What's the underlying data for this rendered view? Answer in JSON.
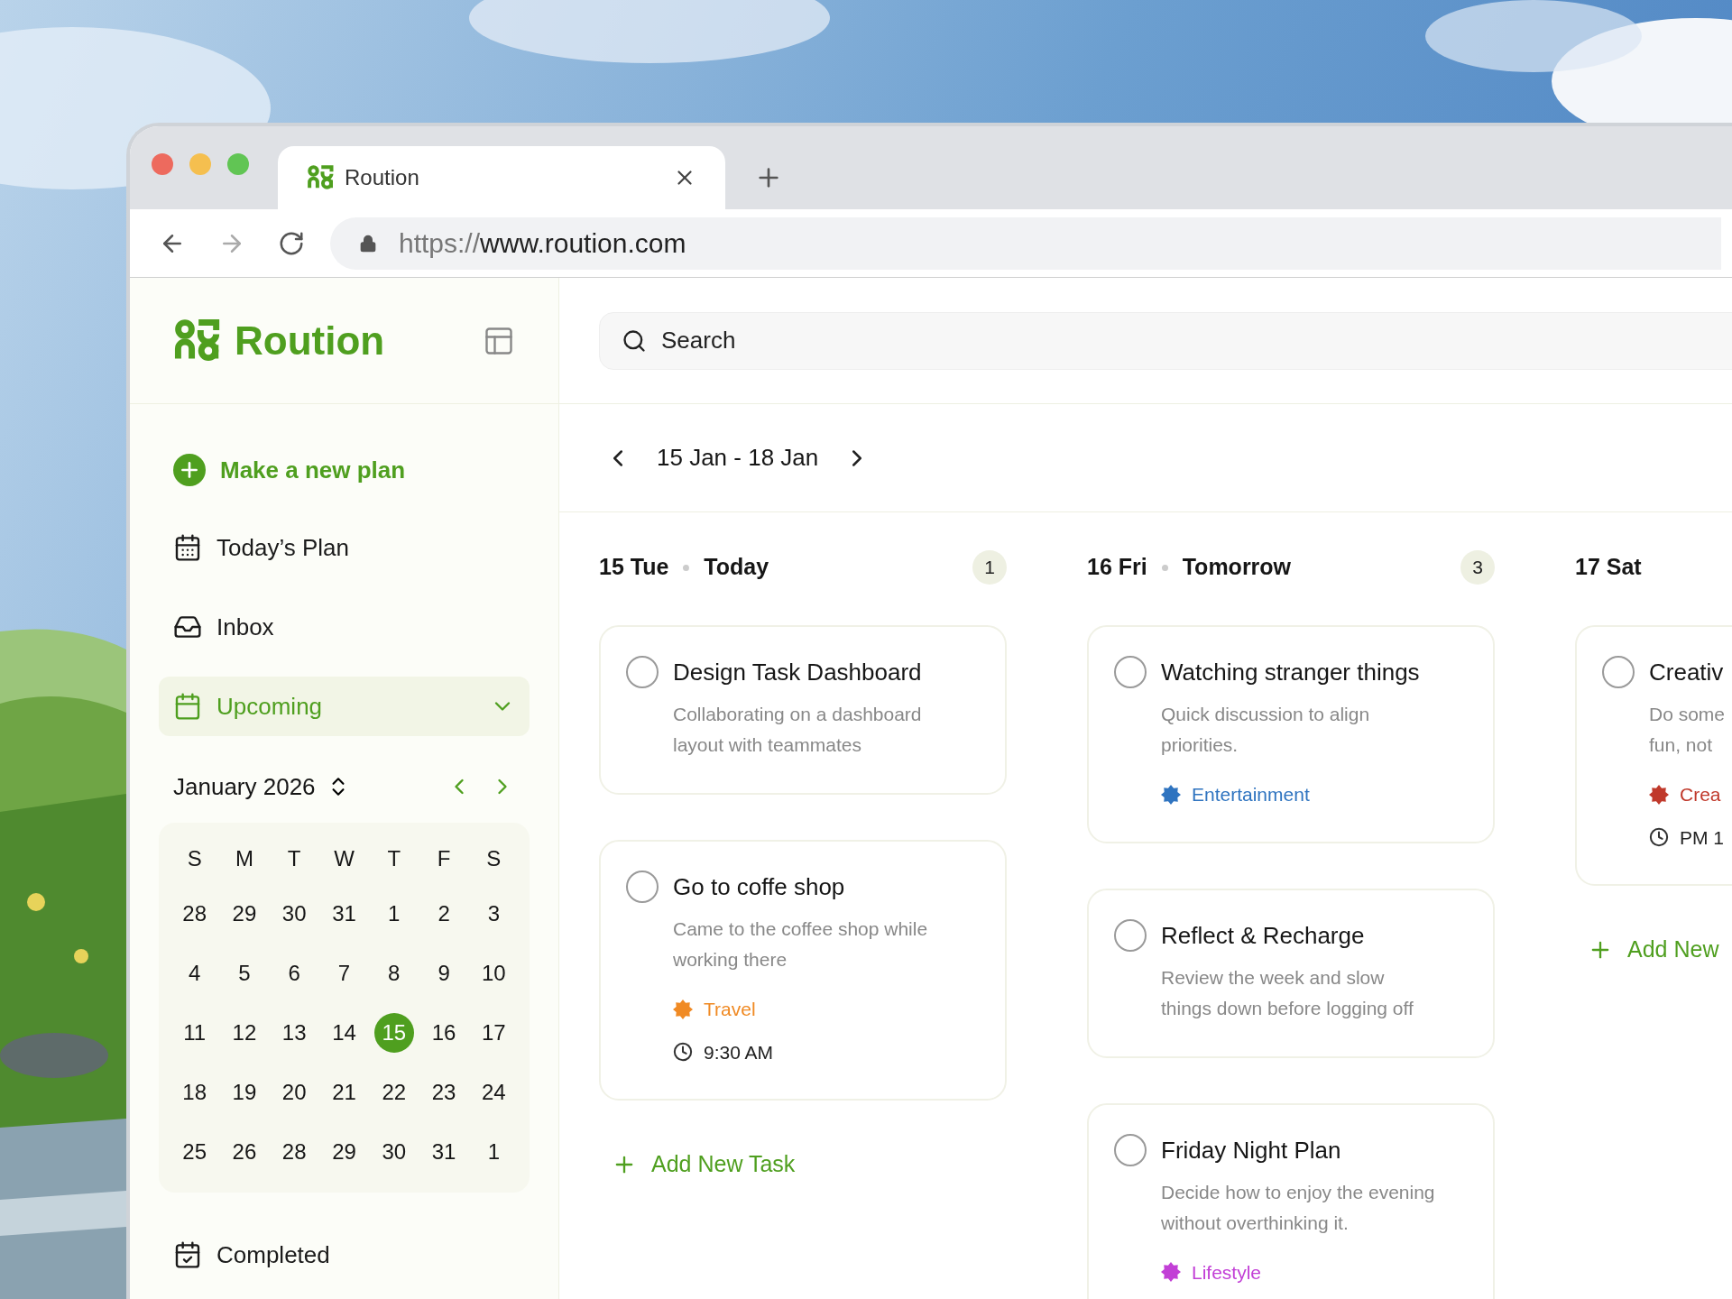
{
  "browser": {
    "tab_title": "Roution",
    "url_scheme": "https://",
    "url_host": "www.roution.com"
  },
  "sidebar": {
    "brand": "Roution",
    "new_plan": "Make a new plan",
    "items": [
      {
        "kind": "today",
        "label": "Today’s Plan",
        "selected": false
      },
      {
        "kind": "inbox",
        "label": "Inbox",
        "selected": false
      },
      {
        "kind": "upcoming",
        "label": "Upcoming",
        "selected": true,
        "expanded": true
      }
    ],
    "calendar": {
      "month": "January 2026",
      "weekdays": [
        "S",
        "M",
        "T",
        "W",
        "T",
        "F",
        "S"
      ],
      "weeks": [
        [
          {
            "day": "28",
            "selected": false
          },
          {
            "day": "29",
            "selected": false
          },
          {
            "day": "30",
            "selected": false
          },
          {
            "day": "31",
            "selected": false
          },
          {
            "day": "1",
            "selected": false
          },
          {
            "day": "2",
            "selected": false
          },
          {
            "day": "3",
            "selected": false
          }
        ],
        [
          {
            "day": "4",
            "selected": false
          },
          {
            "day": "5",
            "selected": false
          },
          {
            "day": "6",
            "selected": false
          },
          {
            "day": "7",
            "selected": false
          },
          {
            "day": "8",
            "selected": false
          },
          {
            "day": "9",
            "selected": false
          },
          {
            "day": "10",
            "selected": false
          }
        ],
        [
          {
            "day": "11",
            "selected": false
          },
          {
            "day": "12",
            "selected": false
          },
          {
            "day": "13",
            "selected": false
          },
          {
            "day": "14",
            "selected": false
          },
          {
            "day": "15",
            "selected": true
          },
          {
            "day": "16",
            "selected": false
          },
          {
            "day": "17",
            "selected": false
          }
        ],
        [
          {
            "day": "18",
            "selected": false
          },
          {
            "day": "19",
            "selected": false
          },
          {
            "day": "20",
            "selected": false
          },
          {
            "day": "21",
            "selected": false
          },
          {
            "day": "22",
            "selected": false
          },
          {
            "day": "23",
            "selected": false
          },
          {
            "day": "24",
            "selected": false
          }
        ],
        [
          {
            "day": "25",
            "selected": false
          },
          {
            "day": "26",
            "selected": false
          },
          {
            "day": "28",
            "selected": false
          },
          {
            "day": "29",
            "selected": false
          },
          {
            "day": "30",
            "selected": false
          },
          {
            "day": "31",
            "selected": false
          },
          {
            "day": "1",
            "selected": false
          }
        ]
      ]
    },
    "bottom_item": {
      "kind": "completed",
      "label": "Completed",
      "selected": false
    }
  },
  "main": {
    "search": {
      "placeholder": "Search"
    },
    "range": "15 Jan - 18 Jan",
    "columns": [
      {
        "date": "15 Tue",
        "label": "Today",
        "count": "1",
        "add": "Add New Task",
        "tasks": [
          {
            "title": "Design Task Dashboard",
            "done": false,
            "description": [
              "Collaborating on a dashboard",
              "layout with teammates"
            ]
          },
          {
            "title": "Go to coffe shop",
            "done": false,
            "description": [
              "Came to the coffee shop while",
              "working there"
            ],
            "tag": {
              "label": "Travel",
              "color": "#f08a24"
            },
            "time": "9:30 AM"
          }
        ]
      },
      {
        "date": "16 Fri",
        "label": "Tomorrow",
        "count": "3",
        "tasks": [
          {
            "title": "Watching stranger things",
            "done": false,
            "description": [
              "Quick discussion to align",
              "priorities."
            ],
            "tag": {
              "label": "Entertainment",
              "color": "#2f74c0"
            }
          },
          {
            "title": "Reflect & Recharge",
            "done": false,
            "description": [
              "Review the week and slow",
              "things down before logging off"
            ]
          },
          {
            "title": "Friday Night Plan",
            "done": false,
            "description": [
              "Decide how to enjoy the evening",
              "without overthinking it."
            ],
            "tag": {
              "label": "Lifestyle",
              "color": "#c23fd6"
            }
          }
        ]
      },
      {
        "date": "17 Sat",
        "add": "Add New",
        "tasks": [
          {
            "title": "Creativ",
            "done": false,
            "description": [
              "Do some",
              "fun, not"
            ],
            "tag": {
              "label": "Crea",
              "color": "#c0392b"
            },
            "time": "PM 1"
          }
        ]
      }
    ]
  }
}
